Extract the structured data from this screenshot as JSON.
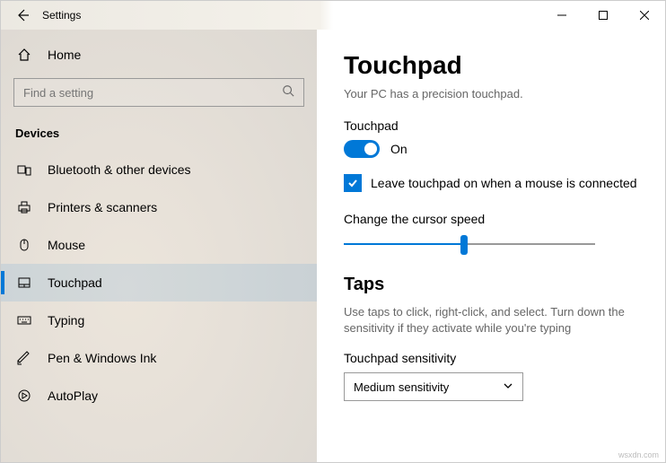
{
  "window": {
    "title": "Settings"
  },
  "sidebar": {
    "home": "Home",
    "search_placeholder": "Find a setting",
    "group": "Devices",
    "items": [
      {
        "label": "Bluetooth & other devices"
      },
      {
        "label": "Printers & scanners"
      },
      {
        "label": "Mouse"
      },
      {
        "label": "Touchpad"
      },
      {
        "label": "Typing"
      },
      {
        "label": "Pen & Windows Ink"
      },
      {
        "label": "AutoPlay"
      }
    ]
  },
  "page": {
    "title": "Touchpad",
    "subtitle": "Your PC has a precision touchpad.",
    "toggle_label": "Touchpad",
    "toggle_state": "On",
    "checkbox_label": "Leave touchpad on when a mouse is connected",
    "slider_label": "Change the cursor speed",
    "taps_heading": "Taps",
    "taps_desc": "Use taps to click, right-click, and select. Turn down the sensitivity if they activate while you're typing",
    "sensitivity_label": "Touchpad sensitivity",
    "sensitivity_value": "Medium sensitivity"
  },
  "watermark": "wsxdn.com"
}
